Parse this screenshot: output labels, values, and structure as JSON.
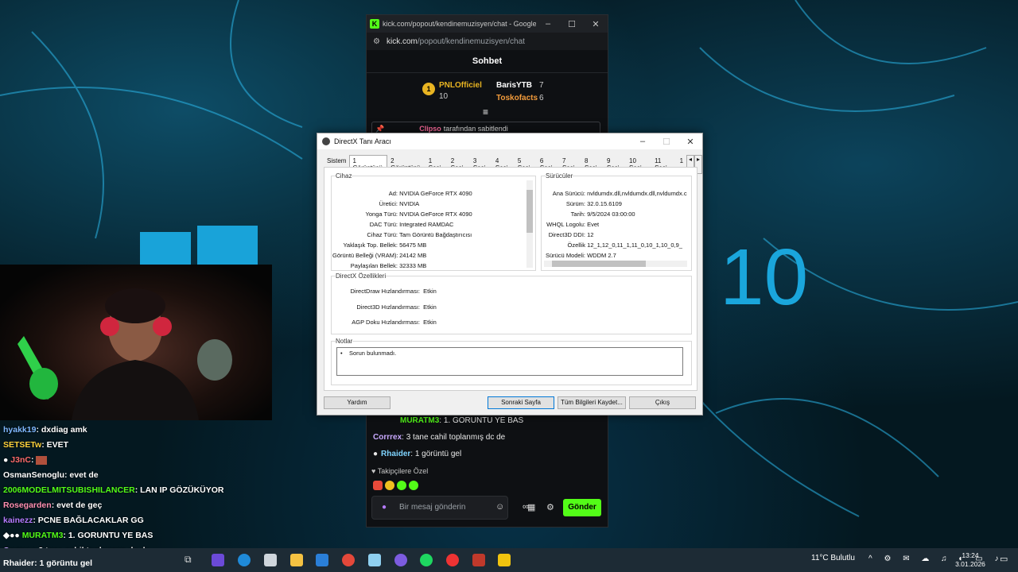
{
  "browser": {
    "tab_title": "kick.com/popout/kendinemuzisyen/chat - Google Ch...",
    "url_domain": "kick.com",
    "url_path": "/popout/kendinemuzisyen/chat",
    "chat_header": "Sohbet",
    "leaderboard": {
      "first": {
        "name": "PNLOfficiel",
        "count": "10",
        "rank": "1"
      },
      "second": {
        "name": "BarisYTB",
        "count": "7"
      },
      "third": {
        "name": "Toskofacts",
        "count": "6"
      }
    },
    "pinned_user": "Clipso",
    "pinned_text": "tarafından sabitlendi",
    "messages": [
      {
        "user": "MURATM3",
        "text": ": 1. GORUNTU YE BAS"
      },
      {
        "user": "Corrrex",
        "text": ": 3 tane cahil toplanmış dc de"
      },
      {
        "user": "Rhaider",
        "text": ": 1 görüntü gel"
      }
    ],
    "follower_emotes_label": "Takipçilere Özel",
    "input_placeholder": "Bir mesaj gönderin",
    "send_label": "Gönder"
  },
  "dxdiag": {
    "title": "DirectX Tanı Aracı",
    "tabs": [
      "Sistem",
      "1 Görüntüsü",
      "2 Görüntüsü",
      "1 Sesi",
      "2 Sesi",
      "3 Sesi",
      "4 Sesi",
      "5 Sesi",
      "6 Sesi",
      "7 Sesi",
      "8 Sesi",
      "9 Sesi",
      "10 Sesi",
      "11 Sesi",
      "1"
    ],
    "device_label": "Cihaz",
    "device": [
      {
        "k": "Ad:",
        "v": "NVIDIA GeForce RTX 4090"
      },
      {
        "k": "Üretici:",
        "v": "NVIDIA"
      },
      {
        "k": "Yonga Türü:",
        "v": "NVIDIA GeForce RTX 4090"
      },
      {
        "k": "DAC Türü:",
        "v": "Integrated RAMDAC"
      },
      {
        "k": "Cihaz Türü:",
        "v": "Tam Görüntü Bağdaştırıcısı"
      },
      {
        "k": "Yaklaşık Top. Bellek:",
        "v": "56475 MB"
      },
      {
        "k": "Görüntü Belleği (VRAM):",
        "v": "24142 MB"
      },
      {
        "k": "Paylaşılan Bellek:",
        "v": "32333 MB"
      }
    ],
    "drivers_label": "Sürücüler",
    "drivers": [
      {
        "k": "Ana Sürücü:",
        "v": "nvldumdx.dll,nvldumdx.dll,nvldumdx.c"
      },
      {
        "k": "Sürüm:",
        "v": "32.0.15.6109"
      },
      {
        "k": "Tarih:",
        "v": "9/5/2024 03:00:00"
      },
      {
        "k": "WHQL Logolu:",
        "v": "Evet"
      },
      {
        "k": "Direct3D DDI:",
        "v": "12"
      },
      {
        "k": "Özellik",
        "v": "12_1,12_0,11_1,11_0,10_1,10_0,9_"
      },
      {
        "k": "Sürücü Modeli:",
        "v": "WDDM 2.7"
      }
    ],
    "features_label": "DirectX Özellikleri",
    "features": [
      {
        "k": "DirectDraw Hızlandırması:",
        "v": "Etkin"
      },
      {
        "k": "Direct3D Hızlandırması:",
        "v": "Etkin"
      },
      {
        "k": "AGP Doku Hızlandırması:",
        "v": "Etkin"
      }
    ],
    "notes_label": "Notlar",
    "notes": "Sorun bulunmadı.",
    "buttons": {
      "help": "Yardım",
      "next": "Sonraki Sayfa",
      "save": "Tüm Bilgileri Kaydet...",
      "exit": "Çıkış"
    }
  },
  "overlay_chat": [
    {
      "user": "hyakk19",
      "text": ": dxdiag amk",
      "color": "#7fb8ff"
    },
    {
      "user": "SETSETw",
      "text": ": EVET",
      "color": "#ffd23c"
    },
    {
      "user": "J3nC",
      "text": ":",
      "color": "#ff6b6b"
    },
    {
      "user": "OsmanSenoglu",
      "text": ": evet de",
      "color": "#ffffff"
    },
    {
      "user": "2006MODELMITSUBISHILANCER",
      "text": ": LAN IP GÖZÜKÜYOR",
      "color": "#53fc18"
    },
    {
      "user": "Rosegarden",
      "text": ": evet de geç",
      "color": "#ff8fb1"
    },
    {
      "user": "kainezz",
      "text": ": PCNE BAĞLACAKLAR GG",
      "color": "#b57bff"
    },
    {
      "user": "MURATM3",
      "text": ": 1. GORUNTU YE BAS",
      "color": "#53fc18"
    },
    {
      "user": "Corrrex",
      "text": ": 3 tane cahil toplanmış dc de",
      "color": "#c9a9ff"
    },
    {
      "user": "Rhaider",
      "text": ": 1 görüntu gel",
      "color": "#ffffff"
    }
  ],
  "taskbar": {
    "weather": "11°C  Bulutlu",
    "time": "13:24",
    "date": "3.01.2026"
  },
  "colors": {
    "kick_green": "#53fc18",
    "win_blue": "#1aa6dc"
  }
}
